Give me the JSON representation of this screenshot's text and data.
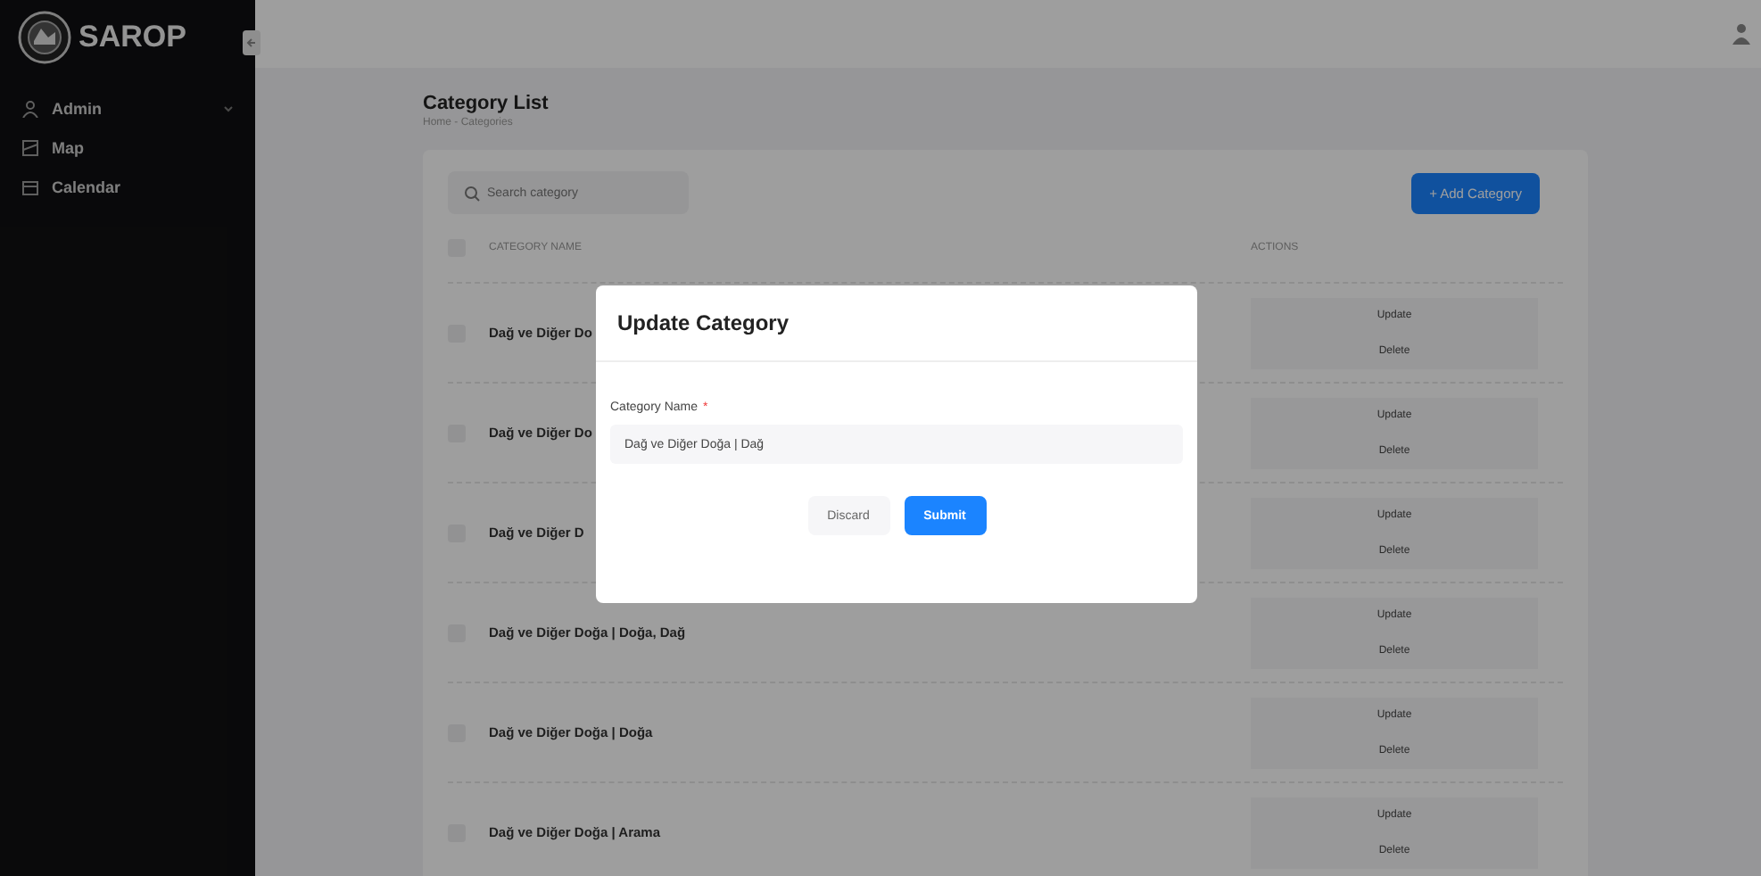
{
  "sidebar": {
    "brand": "SAROP",
    "items": [
      {
        "label": "Admin",
        "kind": "group"
      },
      {
        "label": "Map",
        "kind": "link"
      },
      {
        "label": "Calendar",
        "kind": "link"
      }
    ]
  },
  "page": {
    "title": "Category List",
    "breadcrumb": "Home - Categories"
  },
  "toolbar": {
    "search": {
      "placeholder": "Search category"
    },
    "add_button": "+ Add Category"
  },
  "table": {
    "select_all": {
      "checked": false
    },
    "columns": [
      "CATEGORY NAME",
      "ACTIONS"
    ],
    "rows": [
      {
        "name": "Dağ ve Diğer Do",
        "checked": false,
        "actions": [
          "Update",
          "Delete"
        ]
      },
      {
        "name": "Dağ ve Diğer Do",
        "checked": false,
        "actions": [
          "Update",
          "Delete"
        ]
      },
      {
        "name": "Dağ ve Diğer D",
        "checked": false,
        "actions": [
          "Update",
          "Delete"
        ]
      },
      {
        "name": "Dağ ve Diğer Doğa | Doğa, Dağ",
        "checked": false,
        "actions": [
          "Update",
          "Delete"
        ]
      },
      {
        "name": "Dağ ve Diğer Doğa | Doğa",
        "checked": false,
        "actions": [
          "Update",
          "Delete"
        ]
      },
      {
        "name": "Dağ ve Diğer Doğa | Arama",
        "checked": false,
        "actions": [
          "Update",
          "Delete"
        ]
      }
    ]
  },
  "modal": {
    "title": "Update Category",
    "field_label": "Category Name",
    "required_mark": "*",
    "field_value": "Dağ ve Diğer Doğa | Dağ",
    "buttons": [
      "Discard",
      "Submit"
    ]
  }
}
